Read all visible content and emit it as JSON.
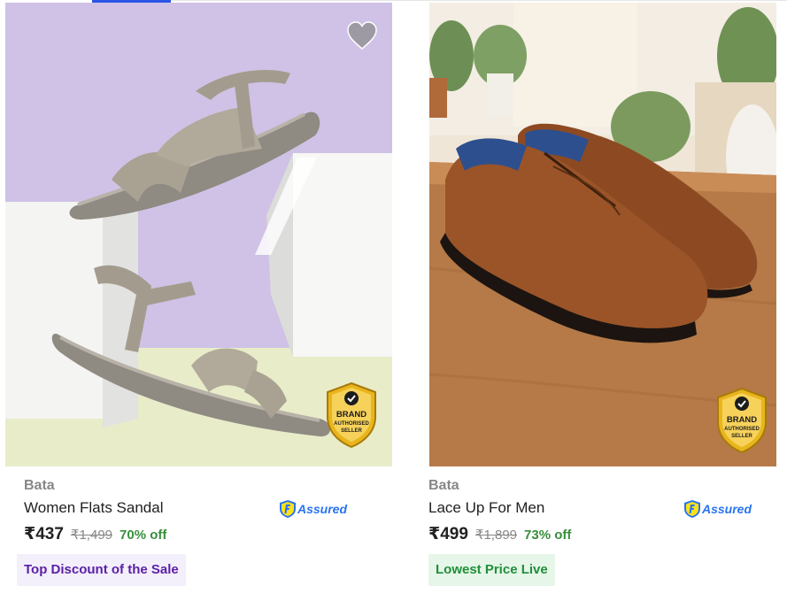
{
  "products": [
    {
      "brand": "Bata",
      "title": "Women Flats Sandal",
      "assured_label": "Assured",
      "price": "₹437",
      "mrp": "₹1,499",
      "discount": "70% off",
      "tag": "Top Discount of the Sale",
      "badge": {
        "line1": "BRAND",
        "line2": "AUTHORISED",
        "line3": "SELLER"
      },
      "wishlist_icon": "heart-icon"
    },
    {
      "brand": "Bata",
      "title": "Lace Up For Men",
      "assured_label": "Assured",
      "price": "₹499",
      "mrp": "₹1,899",
      "discount": "73% off",
      "tag": "Lowest Price Live",
      "badge": {
        "line1": "BRAND",
        "line2": "AUTHORISED",
        "line3": "SELLER"
      },
      "wishlist_icon": "heart-icon"
    }
  ],
  "colors": {
    "accent": "#2874f0",
    "discount_green": "#388e3c",
    "tag_purple_text": "#5b1fa6",
    "tag_green_text": "#1f8f3a",
    "badge_gold": "#e8b51c"
  }
}
